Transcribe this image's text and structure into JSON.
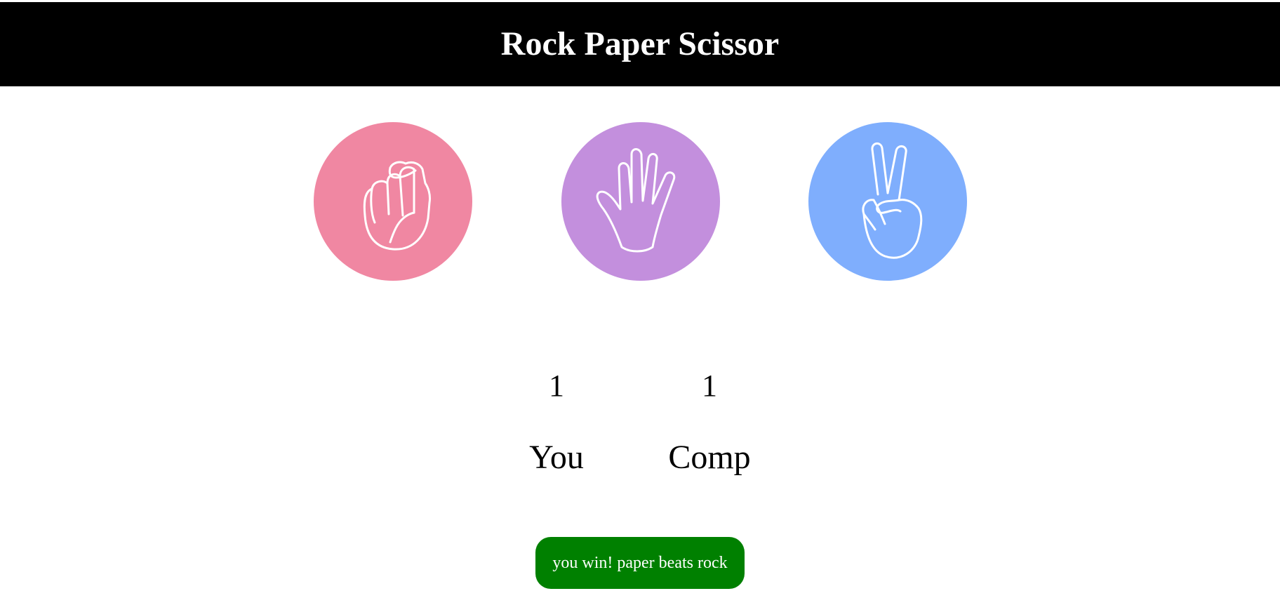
{
  "header": {
    "title": "Rock Paper Scissor"
  },
  "choices": [
    {
      "id": "rock",
      "icon": "fist-icon",
      "color": "#F087A2"
    },
    {
      "id": "paper",
      "icon": "open-hand-icon",
      "color": "#C38FDD"
    },
    {
      "id": "scissor",
      "icon": "peace-sign-icon",
      "color": "#7FAEFD"
    }
  ],
  "scoreboard": {
    "user_score": "1",
    "comp_score": "1",
    "user_label": "You",
    "comp_label": "Comp"
  },
  "message": {
    "text": "you win! paper beats rock",
    "color": "#008000"
  }
}
